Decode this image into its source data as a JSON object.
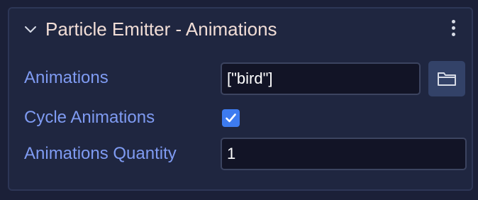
{
  "panel": {
    "title": "Particle Emitter - Animations",
    "collapse_icon": "chevron-down-icon",
    "menu_icon": "more-vertical-icon"
  },
  "fields": {
    "animations": {
      "label": "Animations",
      "value": "[\"bird\"]",
      "browse_icon": "folder-icon"
    },
    "cycle_animations": {
      "label": "Cycle Animations",
      "checked": true,
      "check_icon": "checkmark-icon"
    },
    "animations_quantity": {
      "label": "Animations Quantity",
      "value": "1"
    }
  },
  "colors": {
    "background": "#1b2038",
    "panel": "#1f2640",
    "title": "#f1ddd6",
    "label": "#7f9bf2",
    "accent": "#3d7bf0",
    "input_bg": "#121426"
  }
}
